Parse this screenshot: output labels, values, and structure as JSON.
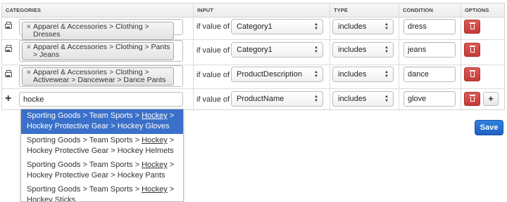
{
  "headers": {
    "categories": "CATEGORIES",
    "input": "INPUT",
    "type": "TYPE",
    "condition": "CONDITION",
    "options": "OPTIONS"
  },
  "rows": [
    {
      "category_tag": "Apparel & Accessories > Clothing > Dresses",
      "if_label": "if value of",
      "input_value": "Category1",
      "type_value": "includes",
      "condition": "dress"
    },
    {
      "category_tag": "Apparel & Accessories > Clothing > Pants > Jeans",
      "if_label": "if value of",
      "input_value": "Category1",
      "type_value": "includes",
      "condition": "jeans"
    },
    {
      "category_tag": "Apparel & Accessories > Clothing > Activewear > Dancewear > Dance Pants",
      "if_label": "if value of",
      "input_value": "ProductDescription",
      "type_value": "includes",
      "condition": "dance"
    },
    {
      "category_input": "hocke",
      "if_label": "if value of",
      "input_value": "ProductName",
      "type_value": "includes",
      "condition": "glove"
    }
  ],
  "suggestions": [
    {
      "pre": "Sporting Goods > Team Sports > ",
      "match": "Hockey",
      "post": " > Hockey Protective Gear > Hockey Gloves",
      "highlighted": true
    },
    {
      "pre": "Sporting Goods > Team Sports > ",
      "match": "Hockey",
      "post": " > Hockey Protective Gear > Hockey Helmets",
      "highlighted": false
    },
    {
      "pre": "Sporting Goods > Team Sports > ",
      "match": "Hockey",
      "post": " > Hockey Protective Gear > Hockey Pants",
      "highlighted": false
    },
    {
      "pre": "Sporting Goods > Team Sports > ",
      "match": "Hockey",
      "post": " > Hockey Sticks",
      "highlighted": false
    }
  ],
  "buttons": {
    "add": "+",
    "save": "Save"
  },
  "colors": {
    "delete": "#c9433d",
    "save": "#2a74d6",
    "highlight": "#3a70c9"
  }
}
